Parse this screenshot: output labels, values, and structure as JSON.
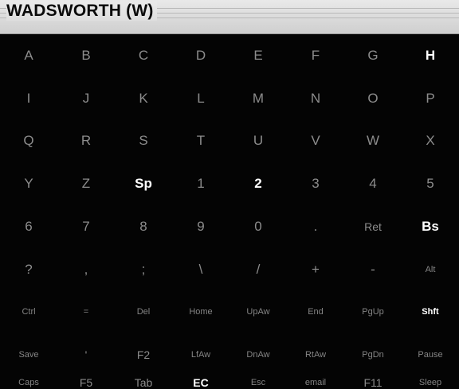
{
  "title_bar": {
    "title": "WADSWORTH (W)"
  },
  "keyboard": {
    "rows": [
      [
        {
          "label": "A"
        },
        {
          "label": "B"
        },
        {
          "label": "C"
        },
        {
          "label": "D"
        },
        {
          "label": "E"
        },
        {
          "label": "F"
        },
        {
          "label": "G"
        },
        {
          "label": "H",
          "highlighted": true
        }
      ],
      [
        {
          "label": "I"
        },
        {
          "label": "J"
        },
        {
          "label": "K"
        },
        {
          "label": "L"
        },
        {
          "label": "M"
        },
        {
          "label": "N"
        },
        {
          "label": "O"
        },
        {
          "label": "P"
        }
      ],
      [
        {
          "label": "Q"
        },
        {
          "label": "R"
        },
        {
          "label": "S"
        },
        {
          "label": "T"
        },
        {
          "label": "U"
        },
        {
          "label": "V"
        },
        {
          "label": "W"
        },
        {
          "label": "X"
        }
      ],
      [
        {
          "label": "Y"
        },
        {
          "label": "Z"
        },
        {
          "label": "Sp",
          "highlighted": true
        },
        {
          "label": "1"
        },
        {
          "label": "2",
          "highlighted": true
        },
        {
          "label": "3"
        },
        {
          "label": "4"
        },
        {
          "label": "5"
        }
      ],
      [
        {
          "label": "6"
        },
        {
          "label": "7"
        },
        {
          "label": "8"
        },
        {
          "label": "9"
        },
        {
          "label": "0"
        },
        {
          "label": "."
        },
        {
          "label": "Ret",
          "size": "md"
        },
        {
          "label": "Bs",
          "highlighted": true
        }
      ],
      [
        {
          "label": "?"
        },
        {
          "label": ","
        },
        {
          "label": ";"
        },
        {
          "label": "\\"
        },
        {
          "label": "/"
        },
        {
          "label": "+"
        },
        {
          "label": "-"
        },
        {
          "label": "Alt",
          "size": "sm"
        }
      ],
      [
        {
          "label": "Ctrl",
          "size": "sm"
        },
        {
          "label": "=",
          "size": "sm"
        },
        {
          "label": "Del",
          "size": "sm"
        },
        {
          "label": "Home",
          "size": "sm"
        },
        {
          "label": "UpAw",
          "size": "sm"
        },
        {
          "label": "End",
          "size": "sm"
        },
        {
          "label": "PgUp",
          "size": "sm"
        },
        {
          "label": "Shft",
          "size": "sm",
          "highlighted": true
        }
      ],
      [
        {
          "label": "Caps",
          "size": "sm"
        },
        {
          "label": "F5",
          "size": "md"
        },
        {
          "label": "Tab",
          "size": "md"
        },
        {
          "label": "EC",
          "size": "md",
          "highlighted": true
        },
        {
          "label": "Esc",
          "size": "sm"
        },
        {
          "label": "email",
          "size": "sm"
        },
        {
          "label": "F11",
          "size": "md"
        },
        {
          "label": "Sleep",
          "size": "sm"
        }
      ]
    ],
    "extra_row_between_ctrl_and_caps": [
      {
        "label": "Save",
        "size": "sm"
      },
      {
        "label": "'",
        "size": "md"
      },
      {
        "label": "F2",
        "size": "md"
      },
      {
        "label": "LfAw",
        "size": "sm"
      },
      {
        "label": "DnAw",
        "size": "sm"
      },
      {
        "label": "RtAw",
        "size": "sm"
      },
      {
        "label": "PgDn",
        "size": "sm"
      },
      {
        "label": "Pause",
        "size": "sm"
      }
    ]
  },
  "colors": {
    "background": "#040404",
    "key_text": "#8c8c8c",
    "key_highlight": "#ffffff",
    "title_bar": "#dedede"
  }
}
